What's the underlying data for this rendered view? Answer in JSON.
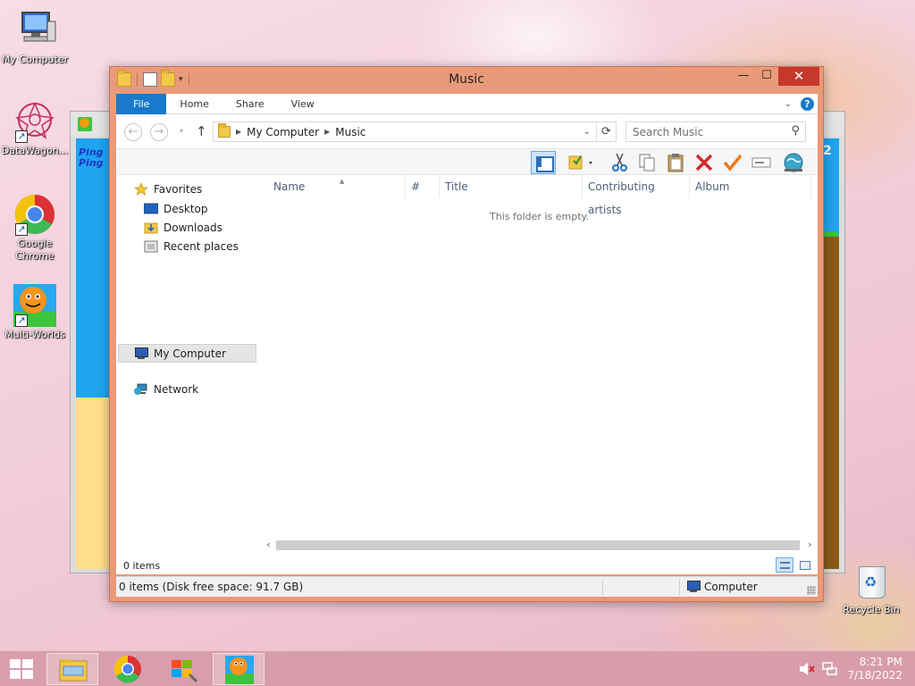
{
  "desktop": {
    "icons": [
      {
        "label": "My Computer",
        "icon": "computer-icon"
      },
      {
        "label": "DataWagon...",
        "icon": "datawagon-icon"
      },
      {
        "label": "Google Chrome",
        "icon": "chrome-icon"
      },
      {
        "label": "Multi-Worlds",
        "icon": "multiworlds-icon"
      }
    ],
    "recycle_bin": {
      "label": "Recycle Bin",
      "icon": "recycle-bin-icon"
    }
  },
  "background_window": {
    "left_text": "Ping\nPing",
    "right_number": "2"
  },
  "explorer": {
    "title": "Music",
    "caption_buttons": {
      "minimize": "—",
      "maximize": "☐",
      "close": "✕"
    },
    "ribbon_tabs": [
      "File",
      "Home",
      "Share",
      "View"
    ],
    "breadcrumb": [
      "My Computer",
      "Music"
    ],
    "search_placeholder": "Search Music",
    "toolbar_icons": [
      "preview-pane-icon",
      "select-folder-icon",
      "cut-icon",
      "copy-icon",
      "paste-icon",
      "delete-icon",
      "check-icon",
      "rename-icon",
      "globe-icon"
    ],
    "nav": {
      "favorites": "Favorites",
      "favorites_items": [
        "Desktop",
        "Downloads",
        "Recent places"
      ],
      "computer": "My Computer",
      "network": "Network"
    },
    "columns": [
      "Name",
      "#",
      "Title",
      "Contributing artists",
      "Album"
    ],
    "empty_message": "This folder is empty.",
    "item_count": "0 items",
    "status": {
      "disk_info": "0 items (Disk free space: 91.7 GB)",
      "location": "Computer"
    },
    "accent_color": "#1979ca",
    "frame_color": "#ea9a78"
  },
  "taskbar": {
    "items": [
      "file-explorer-icon",
      "chrome-icon",
      "windows-update-icon",
      "multiworlds-icon"
    ],
    "time": "8:21 PM",
    "date": "7/18/2022"
  }
}
